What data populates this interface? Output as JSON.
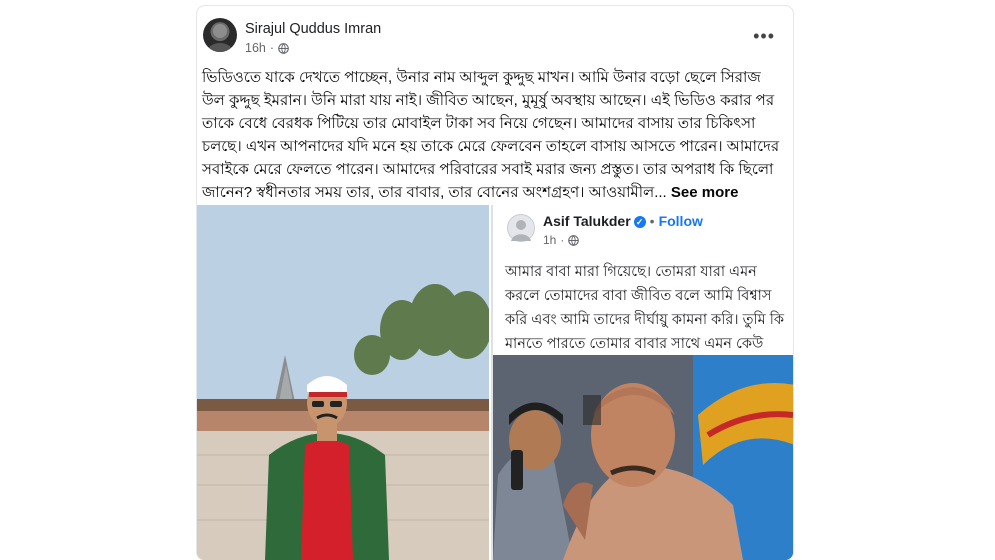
{
  "post": {
    "author": "Sirajul Quddus Imran",
    "time": "16h",
    "privacy_icon": "globe-icon",
    "more_icon": "more-options-icon",
    "text": "ভিডিওতে যাকে  দেখতে পাচ্ছেন, উনার নাম আব্দুল কুদ্দুছ মাখন। আমি উনার বড়ো ছেলে সিরাজ উল কুদ্দুছ ইমরান।  উনি মারা যায় নাই। জীবিত আছেন, মুমূর্ষু অবস্থায় আছেন। এই ভিডিও করার পর তাকে বেধে বেরধক পিটিয়ে তার মোবাইল টাকা সব নিয়ে গেছেন। আমাদের বাসায় তার চিকিৎসা চলছে।  এখন আপনাদের যদি মনে হয় তাকে মেরে ফেলবেন তাহলে বাসায় আসতে পারেন। আমাদের সবাইকে মেরে ফেলতে পারেন। আমাদের পরিবারের সবাই মরার জন্য প্রস্তুত।   তার অপরাধ কি ছিলো জানেন? স্বধীনতার সময় তার, তার বাবার, তার বোনের  অংশগ্রহণ। আওয়ামীল...",
    "see_more": "See more"
  },
  "shared_post": {
    "author": "Asif Talukder",
    "verified_icon": "verified-badge-icon",
    "separator": "•",
    "follow_label": "Follow",
    "time": "1h",
    "privacy_icon": "globe-icon",
    "text": "আমার বাবা মারা গিয়েছে। তোমরা যারা এমন করলে তোমাদের বাবা জীবিত বলে আমি বিশ্বাস করি এবং আমি তাদের দীর্ঘায়ু কামনা করি। তুমি কি মানতে পারতে তোমার বাবার সাথে এমন কেউ করলে ??"
  },
  "colors": {
    "link_blue": "#1877f2",
    "text_primary": "#050505",
    "text_secondary": "#65676b"
  }
}
